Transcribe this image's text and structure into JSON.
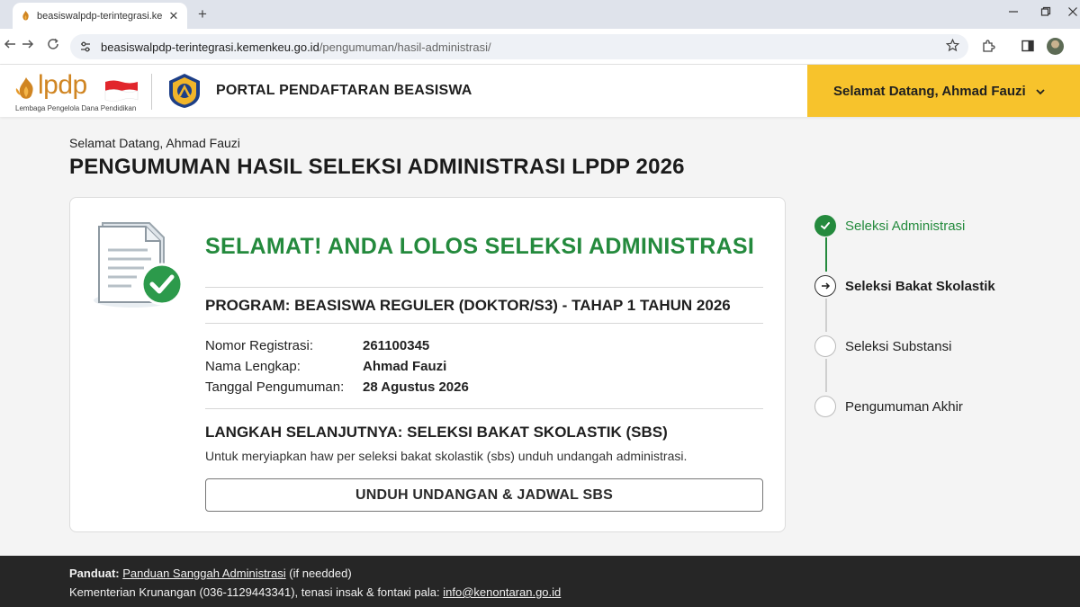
{
  "browser": {
    "tab_title": "beasiswalpdp-terintegrasi.kemen",
    "tab_close": "✕",
    "new_tab": "+",
    "url_host": "beasiswalpdp-terintegrasi.kemenkeu.go.id",
    "url_path": "/pengumuman/hasil-administrasi/"
  },
  "header": {
    "brand_word": "lpdp",
    "brand_subtitle": "Lembaga Pengelola Dana Pendidikan",
    "portal_title": "PORTAL PENDAFTARAN BEASISWA",
    "user_menu_label": "Selamat Datang, Ahmad Fauzi"
  },
  "page": {
    "greeting": "Selamat Datang, Ahmad Fauzi",
    "title": "PENGUMUMAN HASIL SELEKSI ADMINISTRASI LPDP 2026"
  },
  "card": {
    "headline": "SELAMAT! ANDA LOLOS SELEKSI ADMINISTRASI",
    "program": "PROGRAM: BEASISWA REGULER (DOKTOR/S3) - TAHAP 1 TAHUN 2026",
    "details": [
      {
        "label": "Nomor Registrasi:",
        "value": "261100345"
      },
      {
        "label": "Nama Lengkap:",
        "value": "Ahmad Fauzi"
      },
      {
        "label": "Tanggal Pengumuman:",
        "value": "28 Agustus 2026"
      }
    ],
    "next_step_title": "LANGKAH SELANJUTNYA: SELEKSI BAKAT SKOLASTIK (SBS)",
    "next_step_desc": "Untuk meryiapkan haw per seleksi bakat skolastik (sbs) unduh undangah administrasi.",
    "download_button": "UNDUH UNDANGAN & JADWAL SBS"
  },
  "stepper": {
    "steps": [
      {
        "label": "Seleksi Administrasi",
        "status": "done"
      },
      {
        "label": "Seleksi Bakat Skolastik",
        "status": "current"
      },
      {
        "label": "Seleksi Substansi",
        "status": "todo"
      },
      {
        "label": "Pengumuman Akhir",
        "status": "todo"
      }
    ]
  },
  "footer": {
    "guide_prefix": "Panduat:",
    "guide_link": "Panduan Sanggah Administrasi",
    "guide_suffix": "(if needded)",
    "contact_text": "Kementerian Krunangan (036-1129443341), tenasi insak & fontaкi pala:",
    "contact_email": "info@kenontaran.go.id"
  },
  "colors": {
    "accent_yellow": "#f7c32c",
    "success_green": "#248a3d",
    "brand_orange": "#d08522",
    "footer_bg": "#262626"
  }
}
